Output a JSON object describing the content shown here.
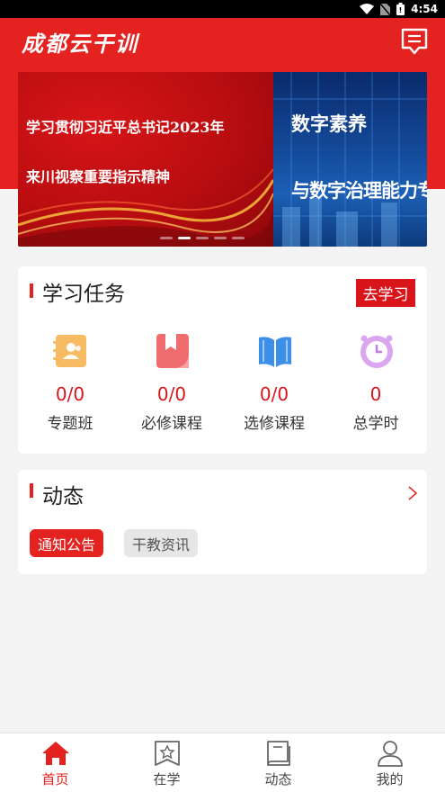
{
  "status_bar": {
    "time": "4:54",
    "icons": [
      "wifi-icon",
      "no-sim-icon",
      "battery-icon"
    ]
  },
  "header": {
    "app_title": "成都云干训",
    "message_icon": "message-icon",
    "background_color": "#e42320"
  },
  "banner": {
    "left_line1": "学习贯彻习近平总书记2023年",
    "left_line2": "来川视察重要指示精神",
    "right_title1": "数字素养",
    "right_title2": "与数字治理能力专栏",
    "slide_count": 5,
    "active_slide": 2
  },
  "tasks": {
    "section_title": "学习任务",
    "go_study_label": "去学习",
    "stats": [
      {
        "value": "0/0",
        "label": "专题班",
        "icon": "class-contact-icon"
      },
      {
        "value": "0/0",
        "label": "必修课程",
        "icon": "required-bookmark-icon"
      },
      {
        "value": "0/0",
        "label": "选修课程",
        "icon": "open-book-icon"
      },
      {
        "value": "0",
        "label": "总学时",
        "icon": "clock-icon"
      }
    ]
  },
  "news": {
    "section_title": "动态",
    "more_icon": "chevron-right-icon",
    "chips": [
      "通知公告",
      "干教资讯"
    ],
    "active_chip": 0
  },
  "tabbar": {
    "tabs": [
      {
        "label": "首页",
        "icon": "home-icon",
        "active": true
      },
      {
        "label": "在学",
        "icon": "star-bookmark-icon",
        "active": false
      },
      {
        "label": "动态",
        "icon": "book-icon",
        "active": false
      },
      {
        "label": "我的",
        "icon": "user-icon",
        "active": false
      }
    ]
  },
  "colors": {
    "accent": "#e42320",
    "button": "#d9151c",
    "page_background": "#f3f3f3"
  }
}
